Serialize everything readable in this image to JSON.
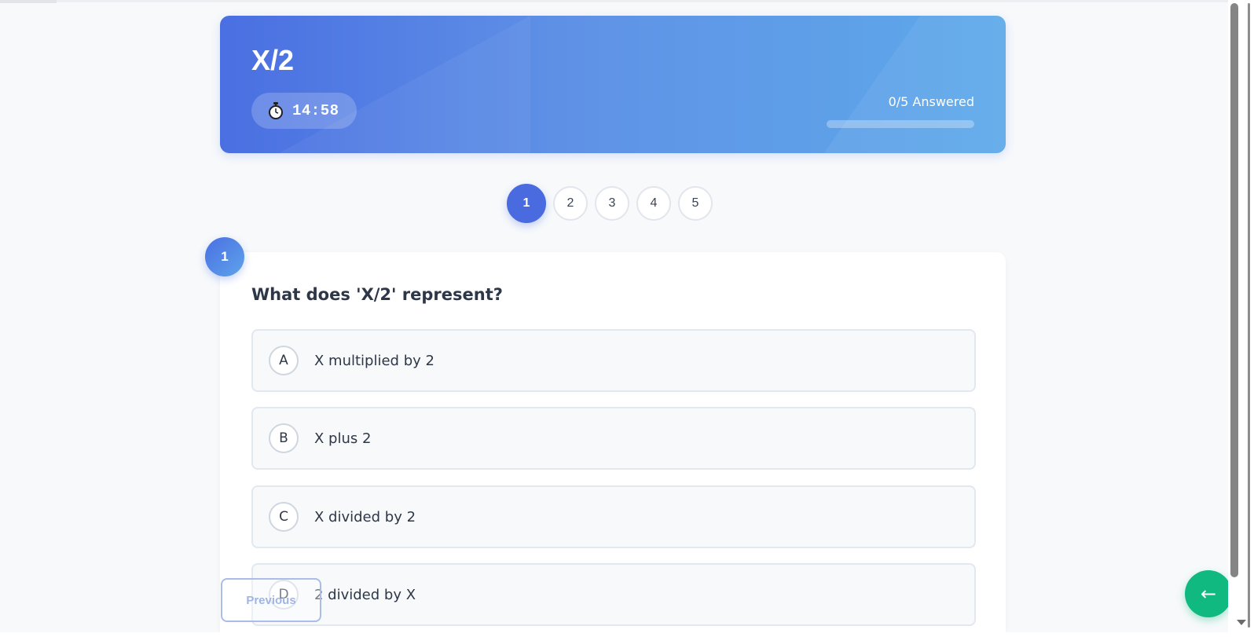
{
  "header": {
    "title": "X/2",
    "timer": "14:58",
    "answered_label": "0/5 Answered",
    "progress_fraction": 0,
    "gradient_start": "#4a6fe2",
    "gradient_end": "#5ea9ea"
  },
  "question_nav": {
    "items": [
      {
        "label": "1",
        "active": true
      },
      {
        "label": "2",
        "active": false
      },
      {
        "label": "3",
        "active": false
      },
      {
        "label": "4",
        "active": false
      },
      {
        "label": "5",
        "active": false
      }
    ]
  },
  "question": {
    "number": "1",
    "text": "What does 'X/2' represent?",
    "options": [
      {
        "letter": "A",
        "text": "X multiplied by 2"
      },
      {
        "letter": "B",
        "text": "X plus 2"
      },
      {
        "letter": "C",
        "text": "X divided by 2"
      },
      {
        "letter": "D",
        "text": "2 divided by X"
      }
    ]
  },
  "footer": {
    "previous_label": "Previous",
    "back_icon": "arrow-left-icon",
    "back_glyph": "←",
    "back_color": "#10b980"
  },
  "accent_color": "#4a6ae0"
}
